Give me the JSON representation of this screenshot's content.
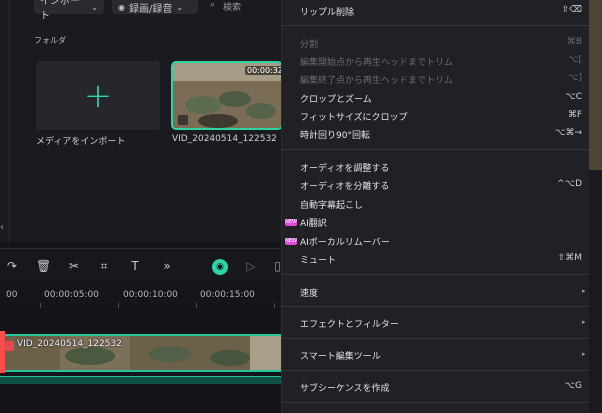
{
  "media_panel": {
    "import_dropdown": "インポート",
    "record_dropdown": "録画/録音",
    "search_placeholder": "検索",
    "folder_label": "フォルダ",
    "import_card_label": "メディアをインポート",
    "video_duration": "00:00:32",
    "video_name": "VID_20240514_122532"
  },
  "timeline": {
    "ruler_labels": [
      "00:00:05:00",
      "00:00:10:00",
      "00:00:15:00"
    ],
    "ruler_start": "00",
    "clip_title": "VID_20240514_122532"
  },
  "context_menu": {
    "ripple_delete": {
      "label": "リップル削除",
      "shortcut": "⇧⌫"
    },
    "split": {
      "label": "分割",
      "shortcut": "⌘B"
    },
    "trim_start": {
      "label": "編集開始点から再生ヘッドまでトリム",
      "shortcut": "⌥["
    },
    "trim_end": {
      "label": "編集終了点から再生ヘッドまでトリム",
      "shortcut": "⌥]"
    },
    "crop_zoom": {
      "label": "クロップとズーム",
      "shortcut": "⌥C"
    },
    "fit_crop": {
      "label": "フィットサイズにクロップ",
      "shortcut": "⌘F"
    },
    "rotate": {
      "label": "時計回り90°回転",
      "shortcut": "⌥⌘→"
    },
    "adjust_audio": {
      "label": "オーディオを調整する",
      "shortcut": ""
    },
    "detach_audio": {
      "label": "オーディオを分離する",
      "shortcut": "^⌥D"
    },
    "auto_caption": {
      "label": "自動字幕起こし",
      "shortcut": ""
    },
    "ai_translate": {
      "label": "AI翻訳",
      "badge": "NEW"
    },
    "ai_vocal": {
      "label": "AIボーカルリムーバー",
      "badge": "NEW"
    },
    "mute": {
      "label": "ミュート",
      "shortcut": "⇧⌘M"
    },
    "speed": {
      "label": "速度"
    },
    "effects_filters": {
      "label": "エフェクトとフィルター"
    },
    "smart_edit": {
      "label": "スマート編集ツール"
    },
    "subsequence": {
      "label": "サブシーケンスを作成",
      "shortcut": "⌥G"
    }
  },
  "colors": {
    "accent": "#2ed3a8",
    "menu_bg": "#202125",
    "playhead": "#ff4c4c"
  }
}
